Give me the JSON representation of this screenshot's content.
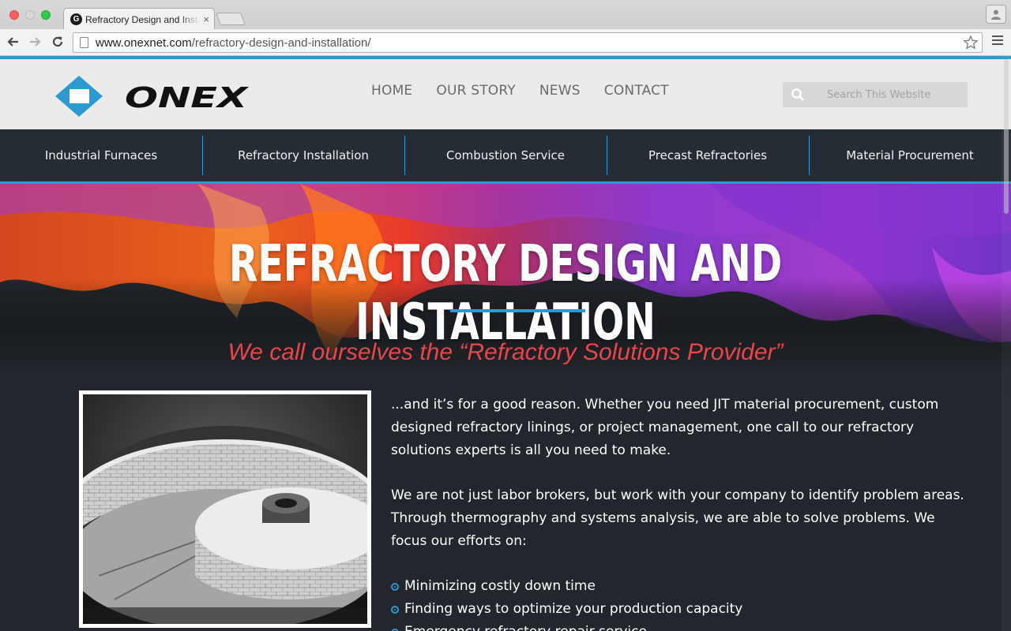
{
  "browser": {
    "tab_title": "Refractory Design and Installation",
    "tab_favicon_letter": "G",
    "tab_close": "×",
    "url_host": "www.onexnet.com",
    "url_path": "/refractory-design-and-installation/"
  },
  "header": {
    "logo_text": "ONEX",
    "nav": [
      "HOME",
      "OUR STORY",
      "NEWS",
      "CONTACT"
    ],
    "search_placeholder": "Search This Website"
  },
  "services": [
    "Industrial Furnaces",
    "Refractory Installation",
    "Combustion Service",
    "Precast Refractories",
    "Material Procurement"
  ],
  "hero": {
    "title": "REFRACTORY DESIGN AND INSTALLATION",
    "tagline": "We call ourselves the “Refractory Solutions Provider”"
  },
  "content": {
    "paragraph1": "...and it’s for a good reason. Whether you need JIT material procurement, custom designed refractory linings, or project management, one call to our refractory solutions experts is all you need to make.",
    "paragraph2": "We are not just labor brokers, but work with your company to identify problem areas.  Through thermography and systems analysis, we are able to solve problems. We focus our efforts on:",
    "focus_items": [
      "Minimizing costly down time",
      "Finding ways to optimize your production capacity",
      "Emergency refractory repair service"
    ]
  },
  "colors": {
    "accent_blue": "#2a9ad0",
    "tagline_red": "#e8464b",
    "dark_bg": "#23272d",
    "header_bg": "#ebebeb"
  }
}
